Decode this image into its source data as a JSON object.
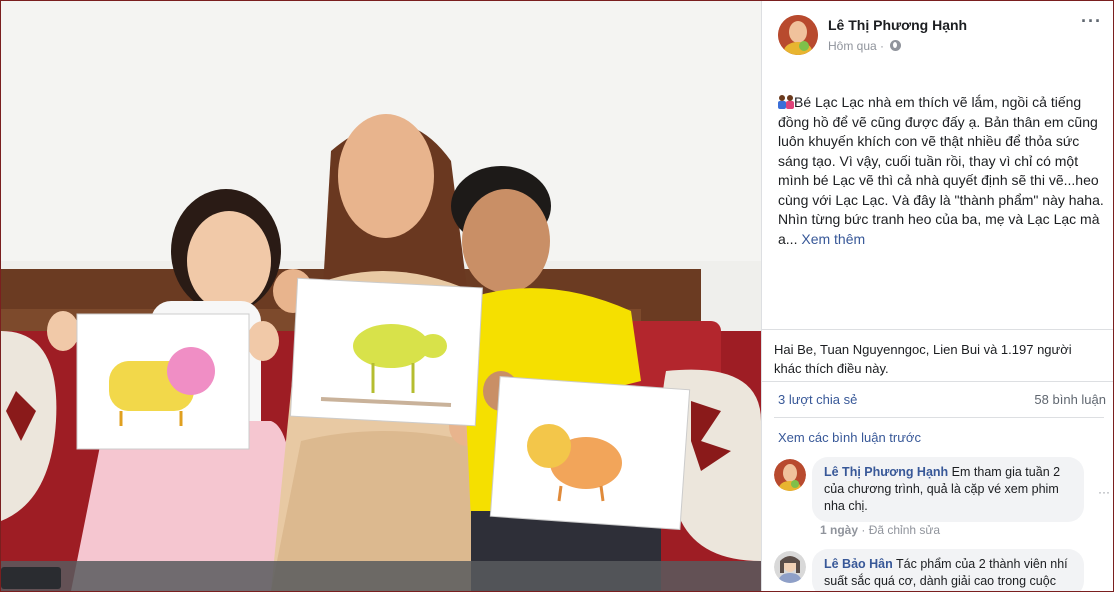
{
  "post": {
    "author": "Lê Thị Phương Hạnh",
    "time": "Hôm qua",
    "more_icon": "···",
    "text": "Bé Lạc Lạc nhà em thích vẽ lắm, ngồi cả tiếng đồng hồ để vẽ cũng được đấy ạ. Bản thân em cũng luôn khuyến khích con vẽ thật nhiều để thỏa sức sáng tạo. Vì vậy, cuối tuần rồi, thay vì chỉ có một mình bé Lạc vẽ thì cả nhà quyết định sẽ thi vẽ...heo cùng với Lạc Lạc. Và đây là \"thành phẩm\" này haha. Nhìn từng bức tranh heo của ba, mẹ và Lạc Lạc mà a...",
    "see_more": "Xem thêm"
  },
  "reactions": {
    "likes_text": "Hai Be, Tuan Nguyenngoc, Lien Bui và 1.197 người khác thích điều này.",
    "shares": "3 lượt chia sẻ",
    "comments_count": "58 bình luận"
  },
  "comments": {
    "view_previous": "Xem các bình luận trước",
    "items": [
      {
        "author": "Lê Thị Phương Hạnh",
        "text": "Em tham gia tuần 2 của chương trình, quả là cặp vé xem phim nha chị.",
        "time": "1 ngày",
        "edited": "Đã chỉnh sửa"
      },
      {
        "author": "Lê Bảo Hân",
        "text": "Tác phẩm của 2 thành viên nhí suất sắc quá cơ, dành giải cao trong cuộc"
      }
    ],
    "options_icon": "···"
  },
  "icons": {
    "globe": "globe-icon",
    "kids_emoji": "kids-icon",
    "more": "more-icon"
  },
  "colors": {
    "link": "#385898",
    "bubble": "#f2f3f5",
    "border_frame": "#7a1f1f",
    "shirt_yellow": "#f5e000"
  }
}
